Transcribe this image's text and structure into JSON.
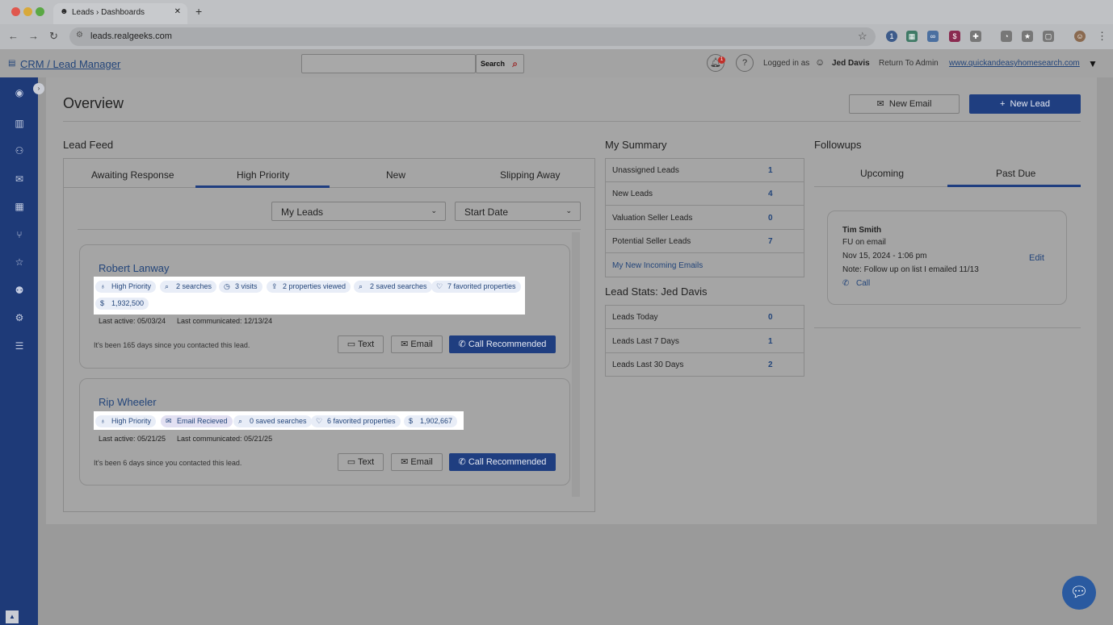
{
  "browser": {
    "tab_title": "Leads › Dashboards",
    "url": "leads.realgeeks.com"
  },
  "header": {
    "app_link": "CRM / Lead Manager",
    "search_label": "Search",
    "notification_count": "1",
    "logged_in_as": "Logged in as",
    "user": "Jed Davis",
    "return_admin": "Return To Admin",
    "site": "www.quickandeasyhomesearch.com"
  },
  "page": {
    "title": "Overview",
    "new_email": "New Email",
    "new_lead": "New Lead"
  },
  "lead_feed": {
    "title": "Lead Feed",
    "tabs": [
      "Awaiting Response",
      "High Priority",
      "New",
      "Slipping Away"
    ],
    "active_tab": "High Priority",
    "filter_leads": "My Leads",
    "filter_date": "Start Date",
    "leads": [
      {
        "name": "Robert Lanway",
        "chips": [
          "High Priority",
          "2 searches",
          "3 visits",
          "2 properties viewed",
          "2 saved searches",
          "7 favorited properties",
          "1,932,500"
        ],
        "last_active": "Last active: 05/03/24",
        "last_communicated": "Last communicated: 12/13/24",
        "note": "It's been 165 days since you contacted this lead.",
        "text_btn": "Text",
        "email_btn": "Email",
        "call_btn": "Call Recommended"
      },
      {
        "name": "Rip Wheeler",
        "chips": [
          "High Priority",
          "Email Recieved",
          "0 saved searches",
          "6 favorited properties",
          "1,902,667"
        ],
        "last_active": "Last active: 05/21/25",
        "last_communicated": "Last communicated: 05/21/25",
        "note": "It's been 6 days since you contacted this lead.",
        "text_btn": "Text",
        "email_btn": "Email",
        "call_btn": "Call Recommended"
      }
    ]
  },
  "summary": {
    "title": "My Summary",
    "rows": [
      {
        "label": "Unassigned Leads",
        "value": "1"
      },
      {
        "label": "New Leads",
        "value": "4"
      },
      {
        "label": "Valuation Seller Leads",
        "value": "0"
      },
      {
        "label": "Potential Seller Leads",
        "value": "7"
      }
    ],
    "incoming_link": "My New Incoming Emails"
  },
  "lead_stats": {
    "title": "Lead Stats: Jed Davis",
    "rows": [
      {
        "label": "Leads Today",
        "value": "0"
      },
      {
        "label": "Leads Last 7 Days",
        "value": "1"
      },
      {
        "label": "Leads Last 30 Days",
        "value": "2"
      }
    ]
  },
  "followups": {
    "title": "Followups",
    "tabs": [
      "Upcoming",
      "Past Due"
    ],
    "active_tab": "Past Due",
    "item": {
      "name": "Tim Smith",
      "type": "FU on email",
      "datetime": "Nov 15, 2024 - 1:06 pm",
      "note": "Note: Follow up on list I emailed 11/13",
      "edit": "Edit",
      "call": "Call"
    }
  },
  "colors": {
    "sidebar": "#1e3a78",
    "primary_button": "#1f3e80",
    "link": "#23457a",
    "overlay_bg": "#a5a5a5",
    "highlight": "#ffffff"
  },
  "icons": [
    "bell-icon",
    "help-icon",
    "search-icon",
    "mail-icon",
    "plus-icon",
    "chat-icon",
    "phone-icon",
    "heart-icon",
    "dollar-icon",
    "clock-icon",
    "upload-icon",
    "ribbon-icon"
  ]
}
